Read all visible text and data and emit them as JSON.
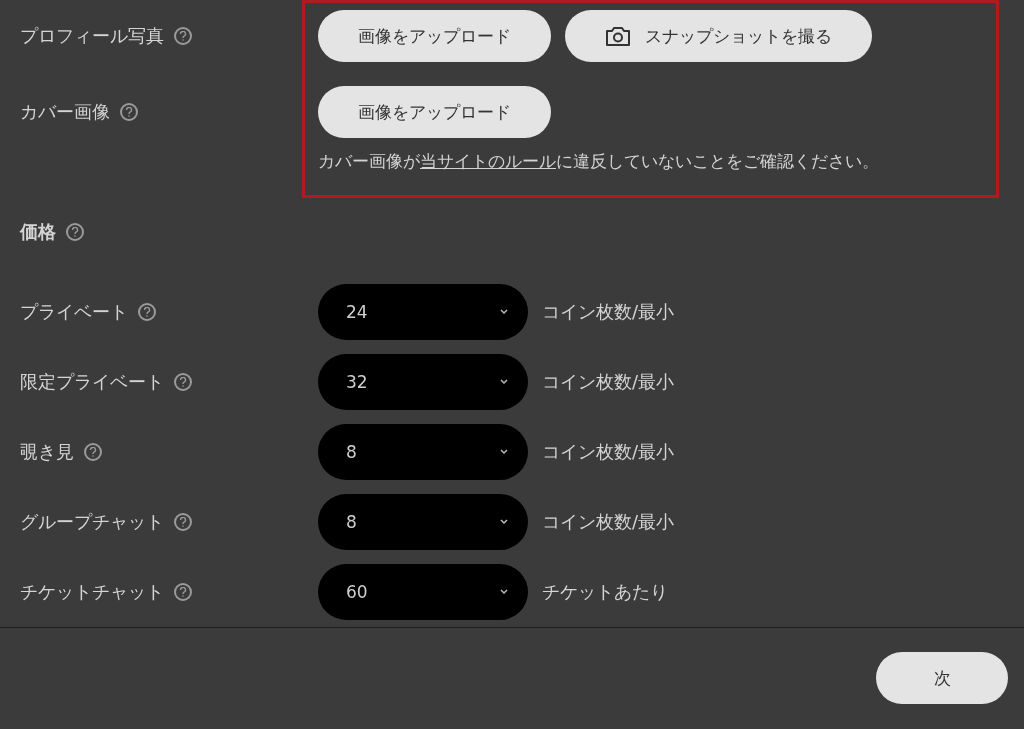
{
  "media": [
    {
      "label": "プロフィール写真",
      "buttons": [
        {
          "kind": "upload",
          "label": "画像をアップロード"
        },
        {
          "kind": "camera",
          "label": "スナップショットを撮る"
        }
      ]
    },
    {
      "label": "カバー画像",
      "buttons": [
        {
          "kind": "upload",
          "label": "画像をアップロード"
        }
      ]
    }
  ],
  "note": {
    "before": "カバー画像が",
    "link": "当サイトのルール",
    "after": "に違反していないことをご確認ください。"
  },
  "highlighted": true,
  "price": {
    "heading": "価格",
    "rows": [
      {
        "label": "プライベート",
        "value": "24",
        "unit": "コイン枚数/最小"
      },
      {
        "label": "限定プライベート",
        "value": "32",
        "unit": "コイン枚数/最小"
      },
      {
        "label": "覗き見",
        "value": "8",
        "unit": "コイン枚数/最小"
      },
      {
        "label": "グループチャット",
        "value": "8",
        "unit": "コイン枚数/最小"
      },
      {
        "label": "チケットチャット",
        "value": "60",
        "unit": "チケットあたり"
      }
    ]
  },
  "next_button": "次"
}
